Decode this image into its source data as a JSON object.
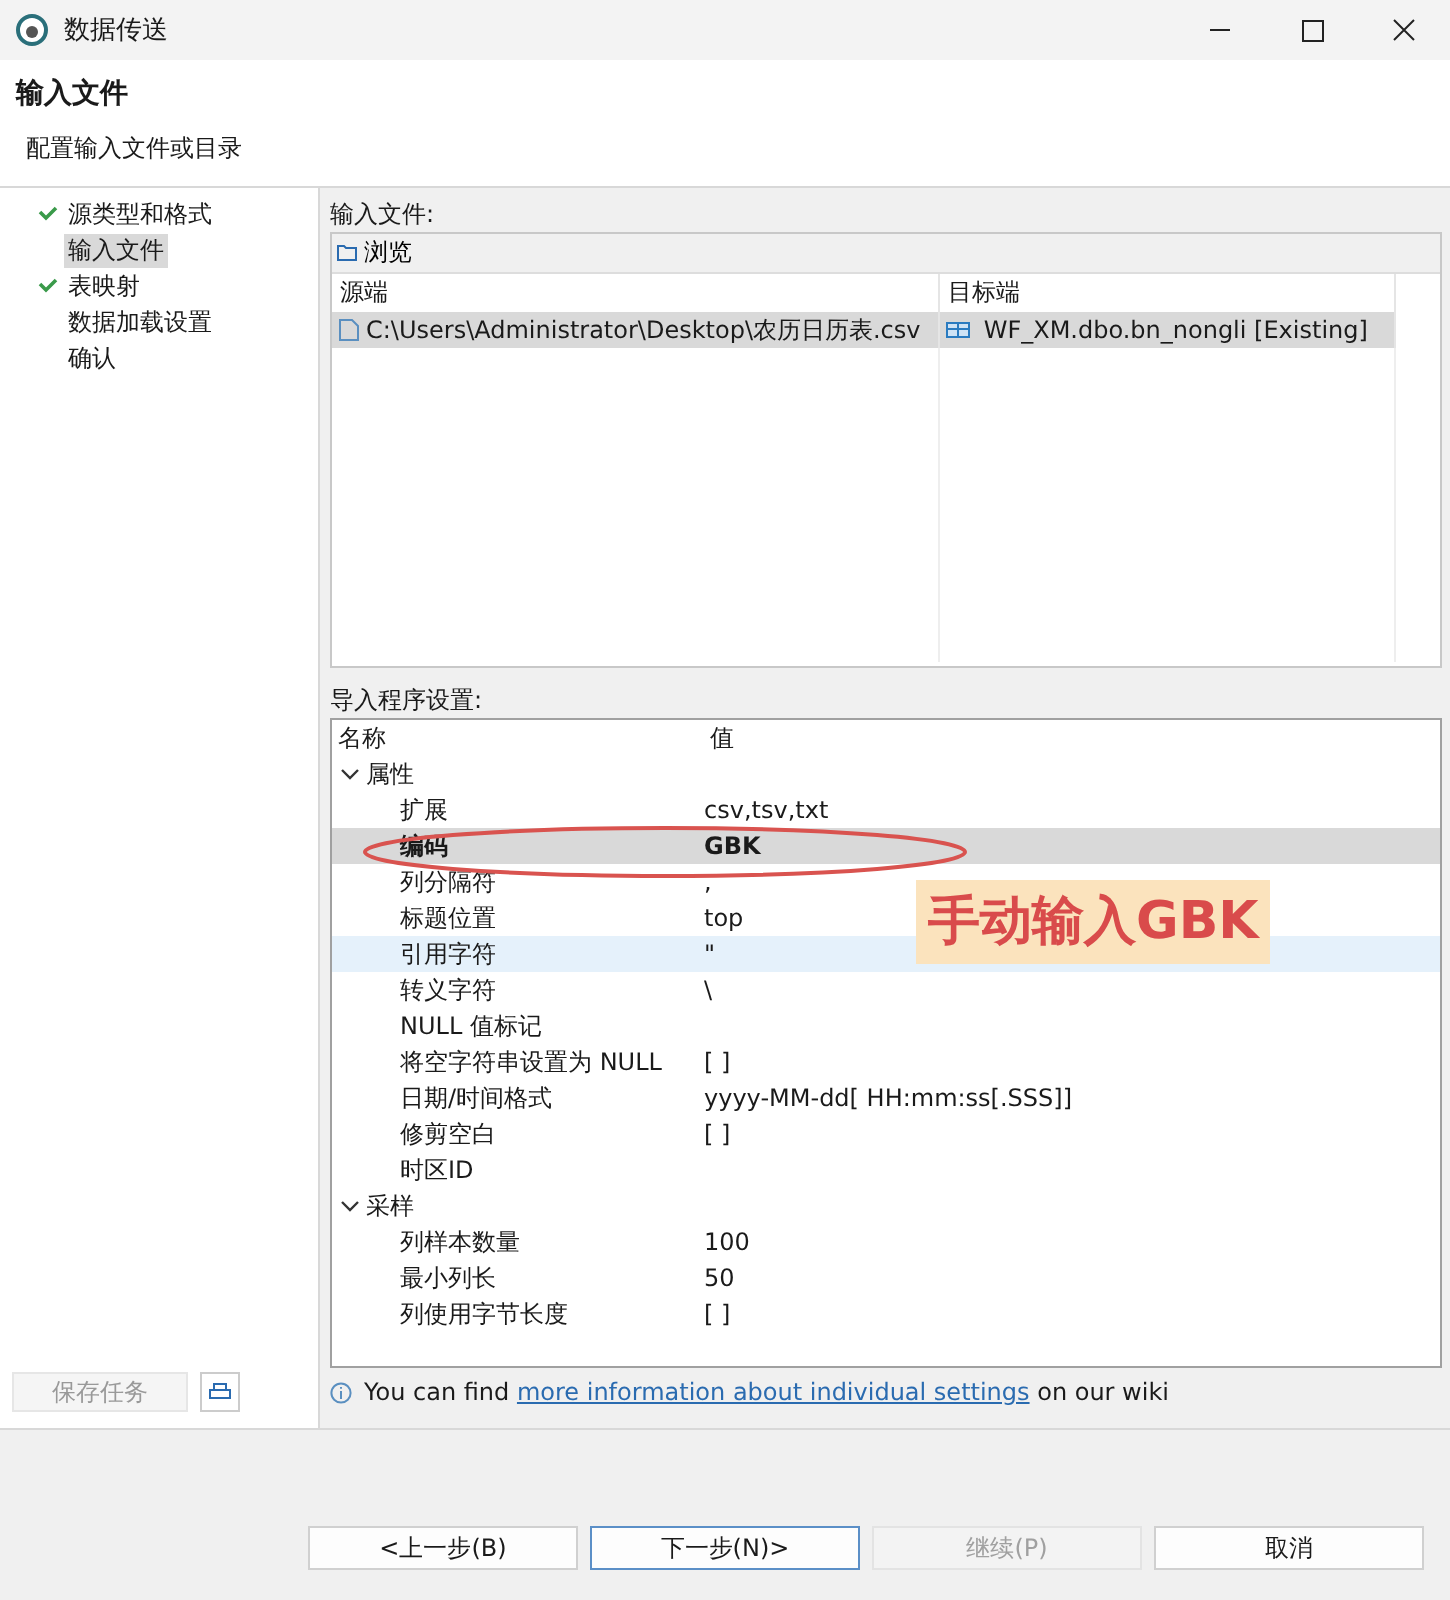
{
  "window": {
    "title": "数据传送"
  },
  "header": {
    "title": "输入文件",
    "subtitle": "配置输入文件或目录"
  },
  "sidebar": {
    "items": [
      {
        "label": "源类型和格式",
        "checked": true,
        "selected": false
      },
      {
        "label": "输入文件",
        "checked": false,
        "selected": true
      },
      {
        "label": "表映射",
        "checked": true,
        "selected": false
      },
      {
        "label": "数据加载设置",
        "checked": false,
        "selected": false
      },
      {
        "label": "确认",
        "checked": false,
        "selected": false
      }
    ],
    "save_button": {
      "label": "保存任务",
      "disabled": true
    }
  },
  "input_files": {
    "label": "输入文件:",
    "browse_button": "浏览",
    "columns": [
      "源端",
      "目标端"
    ],
    "rows": [
      {
        "source": "C:\\Users\\Administrator\\Desktop\\农历日历表.csv",
        "target": "WF_XM.dbo.bn_nongli [Existing]",
        "selected": true
      }
    ]
  },
  "settings": {
    "label": "导入程序设置:",
    "columns": [
      "名称",
      "值"
    ],
    "groups": [
      {
        "name": "属性",
        "expanded": true,
        "children": [
          {
            "name": "扩展",
            "value": "csv,tsv,txt",
            "selected": false,
            "hovered": false
          },
          {
            "name": "编码",
            "value": "GBK",
            "selected": true,
            "hovered": false
          },
          {
            "name": "列分隔符",
            "value": ",",
            "selected": false,
            "hovered": false
          },
          {
            "name": "标题位置",
            "value": "top",
            "selected": false,
            "hovered": false
          },
          {
            "name": "引用字符",
            "value": "\"",
            "selected": false,
            "hovered": true
          },
          {
            "name": "转义字符",
            "value": "\\",
            "selected": false,
            "hovered": false
          },
          {
            "name": "NULL 值标记",
            "selected": false,
            "hovered": false
          },
          {
            "name": "将空字符串设置为 NULL",
            "value": "[ ]",
            "selected": false,
            "hovered": false
          },
          {
            "name": "日期/时间格式",
            "value": "yyyy-MM-dd[ HH:mm:ss[.SSS]]",
            "selected": false,
            "hovered": false
          },
          {
            "name": "修剪空白",
            "value": "[ ]",
            "selected": false,
            "hovered": false
          },
          {
            "name": "时区ID",
            "selected": false,
            "hovered": false
          }
        ]
      },
      {
        "name": "采样",
        "expanded": true,
        "children": [
          {
            "name": "列样本数量",
            "value": "100",
            "selected": false,
            "hovered": false
          },
          {
            "name": "最小列长",
            "value": "50",
            "selected": false,
            "hovered": false
          },
          {
            "name": "列使用字节长度",
            "value": "[ ]",
            "selected": false,
            "hovered": false
          }
        ]
      }
    ],
    "annotation": {
      "text": "手动输入GBK"
    }
  },
  "info": {
    "before": "You can find ",
    "link": "more information about individual settings",
    "after": " on our wiki"
  },
  "buttons": [
    {
      "label": "<上一步(B)",
      "disabled": false,
      "default": false
    },
    {
      "label": "下一步(N)>",
      "disabled": false,
      "default": true
    },
    {
      "label": "继续(P)",
      "disabled": true,
      "default": false
    },
    {
      "label": "取消",
      "disabled": false,
      "default": false
    }
  ]
}
